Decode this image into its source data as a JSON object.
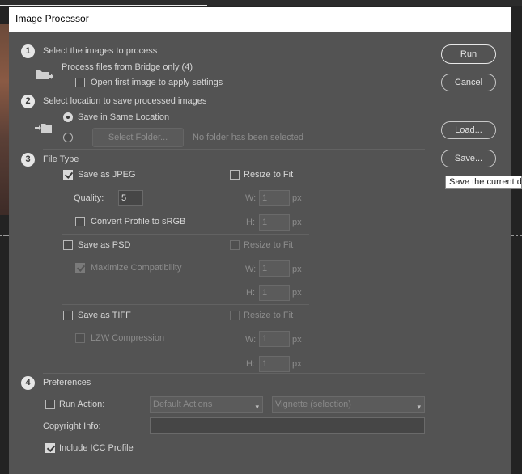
{
  "window": {
    "title": "Image Processor"
  },
  "section1": {
    "number": "1",
    "heading": "Select the images to process",
    "source_text": "Process files from Bridge only (4)",
    "open_first_label": "Open first image to apply settings",
    "open_first_checked": false
  },
  "section2": {
    "number": "2",
    "heading": "Select location to save processed images",
    "same_location_label": "Save in Same Location",
    "select_folder_label": "Select Folder...",
    "no_folder_text": "No folder has been selected"
  },
  "section3": {
    "number": "3",
    "heading": "File Type",
    "jpeg": {
      "label": "Save as JPEG",
      "checked": true,
      "resize_label": "Resize to Fit",
      "quality_label": "Quality:",
      "quality_value": "5",
      "w_label": "W:",
      "w_value": "1",
      "h_label": "H:",
      "h_value": "1",
      "unit": "px",
      "convert_label": "Convert Profile to sRGB"
    },
    "psd": {
      "label": "Save as PSD",
      "checked": false,
      "resize_label": "Resize to Fit",
      "maximize_label": "Maximize Compatibility",
      "maximize_checked": true,
      "w_label": "W:",
      "w_value": "1",
      "h_label": "H:",
      "h_value": "1",
      "unit": "px"
    },
    "tiff": {
      "label": "Save as TIFF",
      "checked": false,
      "resize_label": "Resize to Fit",
      "lzw_label": "LZW Compression",
      "w_label": "W:",
      "w_value": "1",
      "h_label": "H:",
      "h_value": "1",
      "unit": "px"
    }
  },
  "section4": {
    "number": "4",
    "heading": "Preferences",
    "run_action_label": "Run Action:",
    "action_set": "Default Actions",
    "action_name": "Vignette (selection)",
    "copyright_label": "Copyright Info:",
    "copyright_value": "",
    "icc_label": "Include ICC Profile",
    "icc_checked": true
  },
  "buttons": {
    "run": "Run",
    "cancel": "Cancel",
    "load": "Load...",
    "save": "Save..."
  },
  "tooltip": {
    "text": "Save the current dia"
  },
  "icons": {
    "chevron": "▾"
  }
}
